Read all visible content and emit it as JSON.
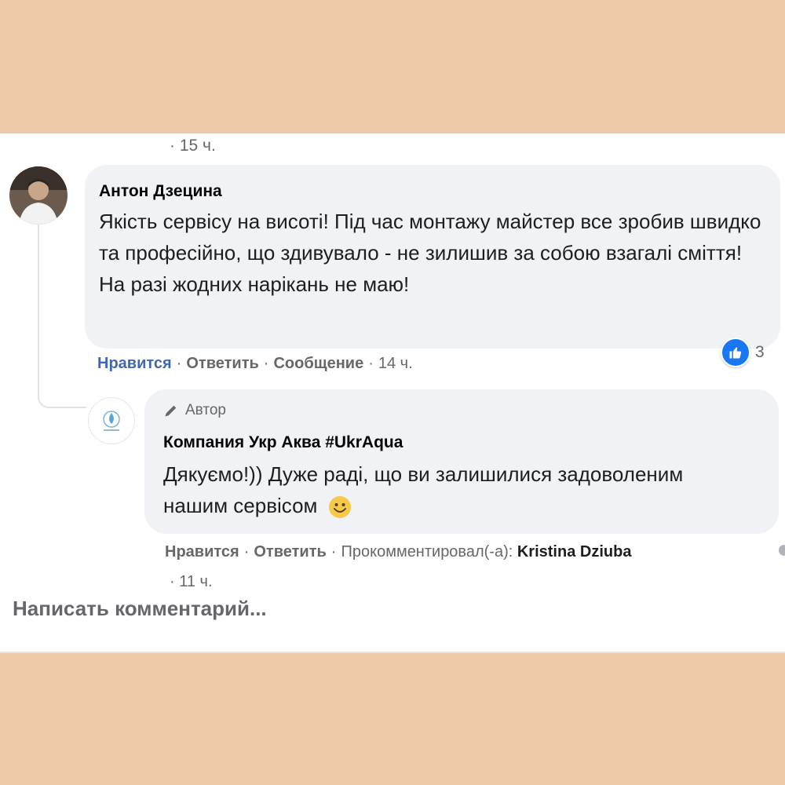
{
  "previous_comment": {
    "time": "· 15 ч."
  },
  "comment": {
    "author": "Антон Дзецина",
    "text": "Якість сервісу на висоті! Під час монтажу майстер все зробив швидко та професійно, що здивувало - не зилишив за собою взагалі сміття! На разі жодних нарікань не маю!",
    "reaction_count": "3",
    "actions": {
      "like": "Нравится",
      "reply": "Ответить",
      "message": "Сообщение",
      "time": "14 ч."
    }
  },
  "reply": {
    "badge": "Автор",
    "author": "Компания Укр Аква #UkrAqua",
    "text": "Дякуємо!)) Дуже раді, що ви залишилися задоволеним нашим сервісом",
    "actions": {
      "like": "Нравится",
      "reply": "Ответить",
      "commented_by_label": "Прокомментировал(-а):",
      "commented_by_name": "Kristina Dziuba"
    },
    "time": "· 11 ч."
  },
  "composer": {
    "placeholder": "Написать комментарий..."
  },
  "colors": {
    "link_blue": "#4267b2",
    "like_blue": "#1877f2",
    "bubble": "#f0f2f5",
    "frame": "#eecaa8"
  }
}
